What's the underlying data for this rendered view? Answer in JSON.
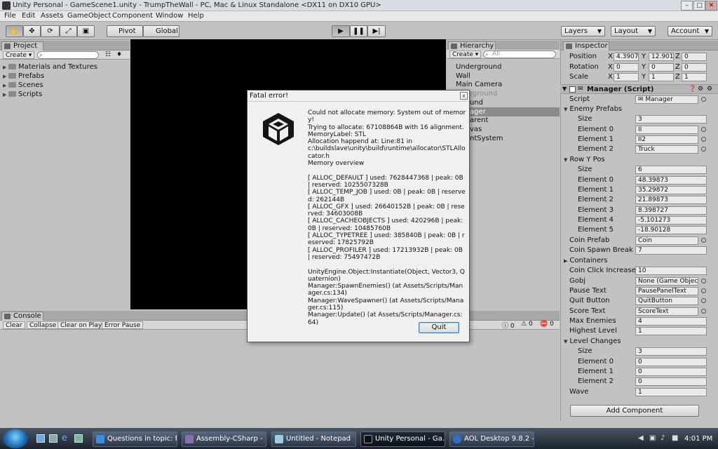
{
  "window": {
    "title": "Unity Personal - GameScene1.unity - TrumpTheWall - PC, Mac & Linux Standalone <DX11 on DX10 GPU>"
  },
  "menu": [
    "File",
    "Edit",
    "Assets",
    "GameObject",
    "Component",
    "Window",
    "Help"
  ],
  "toolbar": {
    "pivot": "Pivot",
    "global": "Global",
    "layers": "Layers",
    "layout": "Layout",
    "account": "Account"
  },
  "project": {
    "tab": "Project",
    "create": "Create",
    "folders": [
      "Materials and Textures",
      "Prefabs",
      "Scenes",
      "Scripts"
    ]
  },
  "hierarchy": {
    "tab": "Hierarchy",
    "create": "Create",
    "search_placeholder": "All",
    "items": [
      "Underground",
      "Wall",
      "Main Camera"
    ],
    "partial_items": [
      "rground",
      "und",
      "ager",
      "arent",
      "vas",
      "ntSystem"
    ]
  },
  "console": {
    "tab": "Console",
    "buttons": [
      "Clear",
      "Collapse",
      "Clear on Play",
      "Error Pause"
    ],
    "counts": [
      "0",
      "0",
      "0"
    ]
  },
  "inspector": {
    "tab": "Inspector",
    "transform": [
      {
        "label": "Position",
        "x": "4.3907",
        "y": "12.901",
        "z": "0"
      },
      {
        "label": "Rotation",
        "x": "0",
        "y": "0",
        "z": "0"
      },
      {
        "label": "Scale",
        "x": "1",
        "y": "1",
        "z": "1"
      }
    ],
    "axis": {
      "x": "X",
      "y": "Y",
      "z": "Z"
    },
    "component_title": "Manager (Script)",
    "script_label": "Script",
    "script_value": "Manager",
    "enemy_prefabs": {
      "label": "Enemy Prefabs",
      "size_label": "Size",
      "size": "3",
      "elements": [
        {
          "label": "Element 0",
          "value": "II"
        },
        {
          "label": "Element 1",
          "value": "II2"
        },
        {
          "label": "Element 2",
          "value": "Truck"
        }
      ]
    },
    "row_y_pos": {
      "label": "Row Y Pos",
      "size_label": "Size",
      "size": "6",
      "elements": [
        {
          "label": "Element 0",
          "value": "48.39873"
        },
        {
          "label": "Element 1",
          "value": "35.29872"
        },
        {
          "label": "Element 2",
          "value": "21.89873"
        },
        {
          "label": "Element 3",
          "value": "8.398727"
        },
        {
          "label": "Element 4",
          "value": "-5.101273"
        },
        {
          "label": "Element 5",
          "value": "-18.90128"
        }
      ]
    },
    "fields_a": [
      {
        "label": "Coin Prefab",
        "value": "Coin",
        "obj": true
      },
      {
        "label": "Coin Spawn Break",
        "value": "7",
        "obj": false
      }
    ],
    "containers_label": "Containers",
    "fields_b": [
      {
        "label": "Coin Click Increase",
        "value": "10",
        "obj": false
      },
      {
        "label": "Gobj",
        "value": "None (Game Object)",
        "obj": true
      },
      {
        "label": "Pause Text",
        "value": "PausePanelText",
        "obj": true
      },
      {
        "label": "Quit Button",
        "value": "QuitButton",
        "obj": true
      },
      {
        "label": "Score Text",
        "value": "ScoreText",
        "obj": true
      },
      {
        "label": "Max Enemies",
        "value": "4",
        "obj": false
      },
      {
        "label": "Highest Level",
        "value": "1",
        "obj": false
      }
    ],
    "level_changes": {
      "label": "Level Changes",
      "size_label": "Size",
      "size": "3",
      "elements": [
        {
          "label": "Element 0",
          "value": "0"
        },
        {
          "label": "Element 1",
          "value": "0"
        },
        {
          "label": "Element 2",
          "value": "0"
        }
      ]
    },
    "wave_label": "Wave",
    "wave_value": "1",
    "add_component": "Add Component"
  },
  "dialog": {
    "title": "Fatal error!",
    "close": "x",
    "message": "Could not allocate memory: System out of memory!\nTrying to allocate: 67108864B with 16 alignment.\nMemoryLabel: STL\nAllocation happend at: Line:81 in\nc:\\buildslave\\unity\\build\\runtime\\allocator\\STLAllocator.h\nMemory overview\n\n[ ALLOC_DEFAULT ] used: 7628447368 | peak: 0B | reserved: 1025507328B\n[ ALLOC_TEMP_JOB ] used: 0B | peak: 0B | reserved: 262144B\n[ ALLOC_GFX ] used: 26640152B | peak: 0B | reserved: 34603008B\n[ ALLOC_CACHEOBJECTS ] used: 420296B | peak: 0B | reserved: 10485760B\n[ ALLOC_TYPETREE ] used: 385840B | peak: 0B | reserved: 17825792B\n[ ALLOC_PROFILER ] used: 17213932B | peak: 0B | reserved: 75497472B\n\nUnityEngine.Object:Instantiate(Object, Vector3, Quaternion)\nManager:SpawnEnemies() (at Assets/Scripts/Manager.cs:134)\nManager:WaveSpawner() (at Assets/Scripts/Manager.cs:115)\nManager:Update() (at Assets/Scripts/Manager.cs:64)",
    "quit": "Quit"
  },
  "taskbar": {
    "tasks": [
      "Questions in topic: f...",
      "Assembly-CSharp - ...",
      "Untitled - Notepad",
      "Unity Personal - Ga...",
      "AOL Desktop 9.8.2 - ..."
    ],
    "clock": "4:01 PM"
  }
}
